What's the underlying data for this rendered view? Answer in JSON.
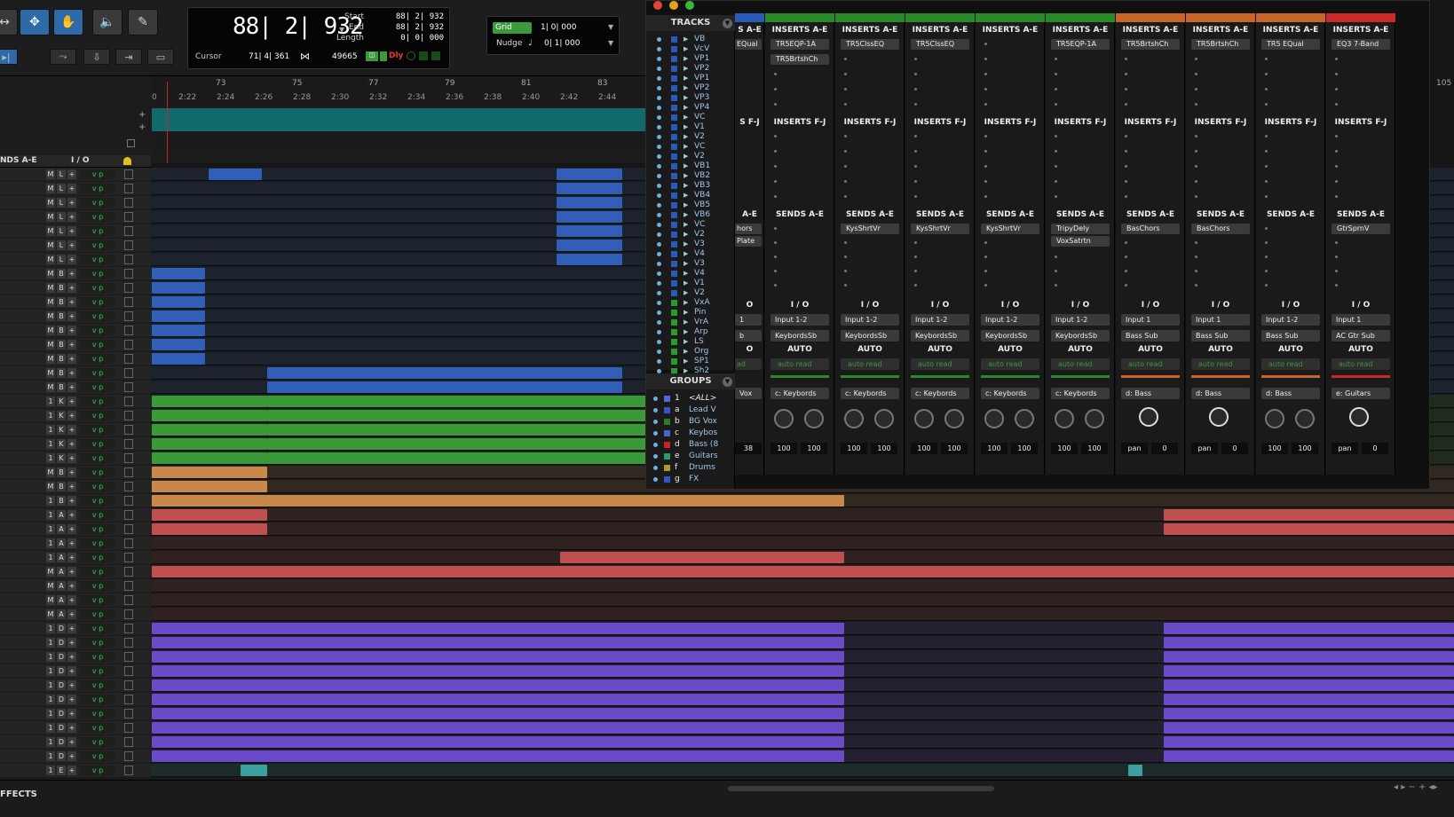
{
  "toolbar": {
    "counter_main": "88| 2| 932",
    "start_label": "Start",
    "end_label": "End",
    "length_label": "Length",
    "start_value": "88| 2| 932",
    "end_value": "88| 2| 932",
    "length_value": "0| 0| 000",
    "cursor_label": "Cursor",
    "cursor_value": "71| 4| 361",
    "samples_value": "49665",
    "dly_label": "Dly",
    "grid_label": "Grid",
    "grid_value": "1| 0| 000",
    "nudge_label": "Nudge",
    "nudge_value": "0| 1| 000"
  },
  "ruler": {
    "bars": [
      "73",
      "75",
      "77",
      "79",
      "81",
      "83",
      "105"
    ],
    "times": [
      "2:22",
      "2:24",
      "2:26",
      "2:28",
      "2:30",
      "2:32",
      "2:34",
      "2:36",
      "2:38",
      "2:40",
      "2:42",
      "2:44"
    ],
    "start_zero": "0"
  },
  "track_header": {
    "sends": "NDS A-E",
    "io": "I / O"
  },
  "tracks_panel": {
    "title": "TRACKS",
    "items": [
      "VB",
      "VcV",
      "VP1",
      "VP2",
      "VP1",
      "VP2",
      "VP3",
      "VP4",
      "VC",
      "V1",
      "V2",
      "VC",
      "V2",
      "VB1",
      "VB2",
      "VB3",
      "VB4",
      "VB5",
      "VB6",
      "VC",
      "V2",
      "V3",
      "V4",
      "V3",
      "V4",
      "V1",
      "V2",
      "VxA",
      "Pin",
      "VrA",
      "Arp",
      "LS",
      "Org",
      "SP1",
      "Sh2"
    ]
  },
  "groups_panel": {
    "title": "GROUPS",
    "items": [
      {
        "letter": "1",
        "name": "<ALL>",
        "color": "#5566dd"
      },
      {
        "letter": "a",
        "name": "Lead V",
        "color": "#3355cc"
      },
      {
        "letter": "b",
        "name": "BG Vox",
        "color": "#2a7a2a"
      },
      {
        "letter": "c",
        "name": "Keybos",
        "color": "#4466cc"
      },
      {
        "letter": "d",
        "name": "Bass (8",
        "color": "#cc2222"
      },
      {
        "letter": "e",
        "name": "Guitars",
        "color": "#2a9a6a"
      },
      {
        "letter": "f",
        "name": "Drums",
        "color": "#aa9922"
      },
      {
        "letter": "g",
        "name": "FX",
        "color": "#3355cc"
      }
    ]
  },
  "mixer": {
    "inserts_ae": "INSERTS A-E",
    "inserts_fj": "INSERTS F-J",
    "sends_ae": "SENDS A-E",
    "io": "I / O",
    "auto": "AUTO",
    "auto_read": "auto read",
    "partial": {
      "inserts": "S A-E",
      "insert0": "EQual",
      "inserts_fj": "S F-J",
      "sends": "A-E",
      "send0": "hors",
      "send1": "Plate",
      "io": "O",
      "in": "1",
      "out": "b",
      "auto": "O",
      "auto_read": "ad",
      "group": "Vox",
      "vol": "38"
    },
    "strips": [
      {
        "color": "#2a8a2a",
        "ins": [
          "TR5EQP-1A",
          "TR5BrtshCh"
        ],
        "sends": [],
        "input": "Input 1-2",
        "output": "KeybordsSb",
        "group": "c: Keybords",
        "knobs": 2,
        "pan": [
          "100",
          "100"
        ]
      },
      {
        "color": "#2a8a2a",
        "ins": [
          "TR5ClssEQ"
        ],
        "sends": [
          "KysShrtVr"
        ],
        "input": "Input 1-2",
        "output": "KeybordsSb",
        "group": "c: Keybords",
        "knobs": 2,
        "pan": [
          "100",
          "100"
        ]
      },
      {
        "color": "#2a8a2a",
        "ins": [
          "TR5ClssEQ"
        ],
        "sends": [
          "KysShrtVr"
        ],
        "input": "Input 1-2",
        "output": "KeybordsSb",
        "group": "c: Keybords",
        "knobs": 2,
        "pan": [
          "100",
          "100"
        ]
      },
      {
        "color": "#2a8a2a",
        "ins": [],
        "sends": [
          "KysShrtVr"
        ],
        "input": "Input 1-2",
        "output": "KeybordsSb",
        "group": "c: Keybords",
        "knobs": 2,
        "pan": [
          "100",
          "100"
        ]
      },
      {
        "color": "#2a8a2a",
        "ins": [
          "TR5EQP-1A"
        ],
        "sends": [
          "TripyDely",
          "VoxSatrtn"
        ],
        "input": "Input 1-2",
        "output": "KeybordsSb",
        "group": "c: Keybords",
        "knobs": 2,
        "pan": [
          "100",
          "100"
        ]
      },
      {
        "color": "#c8662a",
        "ins": [
          "TR5BrtshCh"
        ],
        "sends": [
          "BasChors"
        ],
        "input": "Input 1",
        "output": "Bass Sub",
        "group": "d: Bass",
        "knobs": 1,
        "pan": [
          "pan",
          "0"
        ]
      },
      {
        "color": "#c8662a",
        "ins": [
          "TR5BrtshCh"
        ],
        "sends": [
          "BasChors"
        ],
        "input": "Input 1",
        "output": "Bass Sub",
        "group": "d: Bass",
        "knobs": 1,
        "pan": [
          "pan",
          "0"
        ]
      },
      {
        "color": "#c8662a",
        "ins": [
          "TR5 EQual"
        ],
        "sends": [],
        "input": "Input 1-2",
        "output": "Bass Sub",
        "group": "d: Bass",
        "knobs": 2,
        "pan": [
          "100",
          "100"
        ]
      },
      {
        "color": "#c82a2a",
        "ins": [
          "EQ3 7-Band"
        ],
        "sends": [
          "GtrSprnV"
        ],
        "input": "Input 1",
        "output": "AC Gtr Sub",
        "group": "e: Guitars",
        "knobs": 1,
        "pan": [
          "pan",
          "0"
        ]
      }
    ]
  },
  "track_rows": [
    {
      "a": "M",
      "b": "L",
      "c": "#2f5fb8"
    },
    {
      "a": "M",
      "b": "L",
      "c": "#2f5fb8"
    },
    {
      "a": "M",
      "b": "L",
      "c": "#2f5fb8"
    },
    {
      "a": "M",
      "b": "L",
      "c": "#2f5fb8"
    },
    {
      "a": "M",
      "b": "L",
      "c": "#2f5fb8"
    },
    {
      "a": "M",
      "b": "L",
      "c": "#2f5fb8"
    },
    {
      "a": "M",
      "b": "L",
      "c": "#2f5fb8"
    },
    {
      "a": "M",
      "b": "B",
      "c": "#2f5fb8"
    },
    {
      "a": "M",
      "b": "B",
      "c": "#2f5fb8"
    },
    {
      "a": "M",
      "b": "B",
      "c": "#2f5fb8"
    },
    {
      "a": "M",
      "b": "B",
      "c": "#2f5fb8"
    },
    {
      "a": "M",
      "b": "B",
      "c": "#2f5fb8"
    },
    {
      "a": "M",
      "b": "B",
      "c": "#2f5fb8"
    },
    {
      "a": "M",
      "b": "B",
      "c": "#2f5fb8"
    },
    {
      "a": "M",
      "b": "B",
      "c": "#2f5fb8"
    },
    {
      "a": "M",
      "b": "B",
      "c": "#2f5fb8"
    },
    {
      "a": "1",
      "b": "K",
      "c": "#3a9a3a"
    },
    {
      "a": "1",
      "b": "K",
      "c": "#3a9a3a"
    },
    {
      "a": "1",
      "b": "K",
      "c": "#3a9a3a"
    },
    {
      "a": "1",
      "b": "K",
      "c": "#3a9a3a"
    },
    {
      "a": "1",
      "b": "K",
      "c": "#3a9a3a"
    },
    {
      "a": "M",
      "b": "B",
      "c": "#c8884a"
    },
    {
      "a": "M",
      "b": "B",
      "c": "#c8884a"
    },
    {
      "a": "1",
      "b": "B",
      "c": "#c8884a"
    },
    {
      "a": "1",
      "b": "A",
      "c": "#c05050"
    },
    {
      "a": "1",
      "b": "A",
      "c": "#c05050"
    },
    {
      "a": "1",
      "b": "A",
      "c": "#c05050"
    },
    {
      "a": "1",
      "b": "A",
      "c": "#c05050"
    },
    {
      "a": "M",
      "b": "A",
      "c": "#c05050"
    },
    {
      "a": "M",
      "b": "A",
      "c": "#c05050"
    },
    {
      "a": "M",
      "b": "A",
      "c": "#c05050"
    },
    {
      "a": "M",
      "b": "A",
      "c": "#c05050"
    },
    {
      "a": "1",
      "b": "D",
      "c": "#6a4ac8"
    },
    {
      "a": "1",
      "b": "D",
      "c": "#6a4ac8"
    },
    {
      "a": "1",
      "b": "D",
      "c": "#6a4ac8"
    },
    {
      "a": "1",
      "b": "D",
      "c": "#6a4ac8"
    },
    {
      "a": "1",
      "b": "D",
      "c": "#6a4ac8"
    },
    {
      "a": "1",
      "b": "D",
      "c": "#6a4ac8"
    },
    {
      "a": "1",
      "b": "D",
      "c": "#6a4ac8"
    },
    {
      "a": "1",
      "b": "D",
      "c": "#6a4ac8"
    },
    {
      "a": "1",
      "b": "D",
      "c": "#6a4ac8"
    },
    {
      "a": "1",
      "b": "D",
      "c": "#6a4ac8"
    },
    {
      "a": "1",
      "b": "E",
      "c": "#3aa0a0"
    }
  ],
  "vp_label": "v p",
  "bottom_bar": {
    "effects": "FFECTS"
  }
}
